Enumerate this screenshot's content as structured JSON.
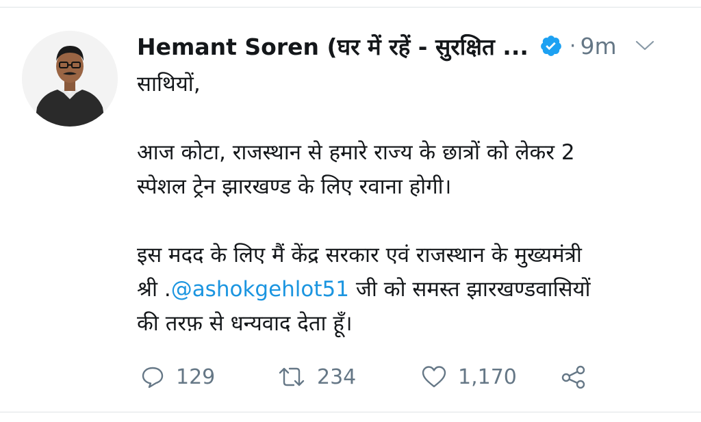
{
  "tweet": {
    "author": {
      "display_name": "Hemant Soren (घर में रहें - सुरक्षित ...",
      "verified": true,
      "avatar_icon": "person-avatar"
    },
    "separator": "·",
    "time_ago": "9m",
    "body": {
      "line1": "साथियों,",
      "line2": "आज कोटा, राजस्थान से हमारे राज्य के छात्रों को लेकर 2",
      "line3": "स्पेशल ट्रेन झारखण्ड के लिए रवाना होगी।",
      "line4": "इस मदद के लिए मैं केंद्र सरकार एवं राजस्थान के मुख्यमंत्री",
      "line5_prefix": "श्री .",
      "mention": "@ashokgehlot51",
      "line5_suffix": " जी को समस्त झारखण्डवासियों",
      "line6": "की तरफ़ से धन्यवाद देता हूँ।"
    },
    "actions": {
      "replies": "129",
      "retweets": "234",
      "likes": "1,170"
    },
    "colors": {
      "text": "#14171a",
      "muted": "#657786",
      "link": "#1b95e0",
      "verified": "#1da1f2"
    }
  }
}
